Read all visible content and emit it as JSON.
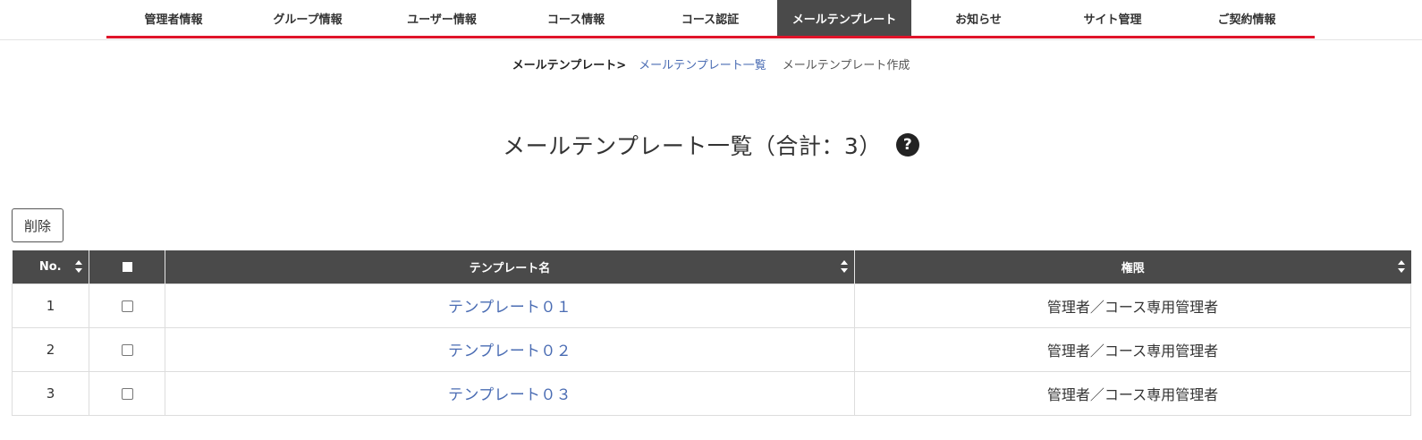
{
  "nav": {
    "items": [
      {
        "label": "管理者情報"
      },
      {
        "label": "グループ情報"
      },
      {
        "label": "ユーザー情報"
      },
      {
        "label": "コース情報"
      },
      {
        "label": "コース認証"
      },
      {
        "label": "メールテンプレート"
      },
      {
        "label": "お知らせ"
      },
      {
        "label": "サイト管理"
      },
      {
        "label": "ご契約情報"
      }
    ],
    "active_index": 5
  },
  "breadcrumb": {
    "section": "メールテンプレート>",
    "list_link": "メールテンプレート一覧",
    "create_link": "メールテンプレート作成"
  },
  "page": {
    "title": "メールテンプレート一覧（合計：3）",
    "help_icon": "question-circle-icon",
    "help_glyph": "?"
  },
  "actions": {
    "delete_label": "削除"
  },
  "table": {
    "headers": {
      "no": "No.",
      "name": "テンプレート名",
      "permission": "権限"
    },
    "rows": [
      {
        "no": "1",
        "name": "テンプレート０１",
        "permission": "管理者／コース専用管理者"
      },
      {
        "no": "2",
        "name": "テンプレート０２",
        "permission": "管理者／コース専用管理者"
      },
      {
        "no": "3",
        "name": "テンプレート０３",
        "permission": "管理者／コース専用管理者"
      }
    ]
  },
  "colors": {
    "accent_red": "#e0142a",
    "header_dark": "#4a4a4a",
    "link_blue": "#4a6cb3"
  }
}
